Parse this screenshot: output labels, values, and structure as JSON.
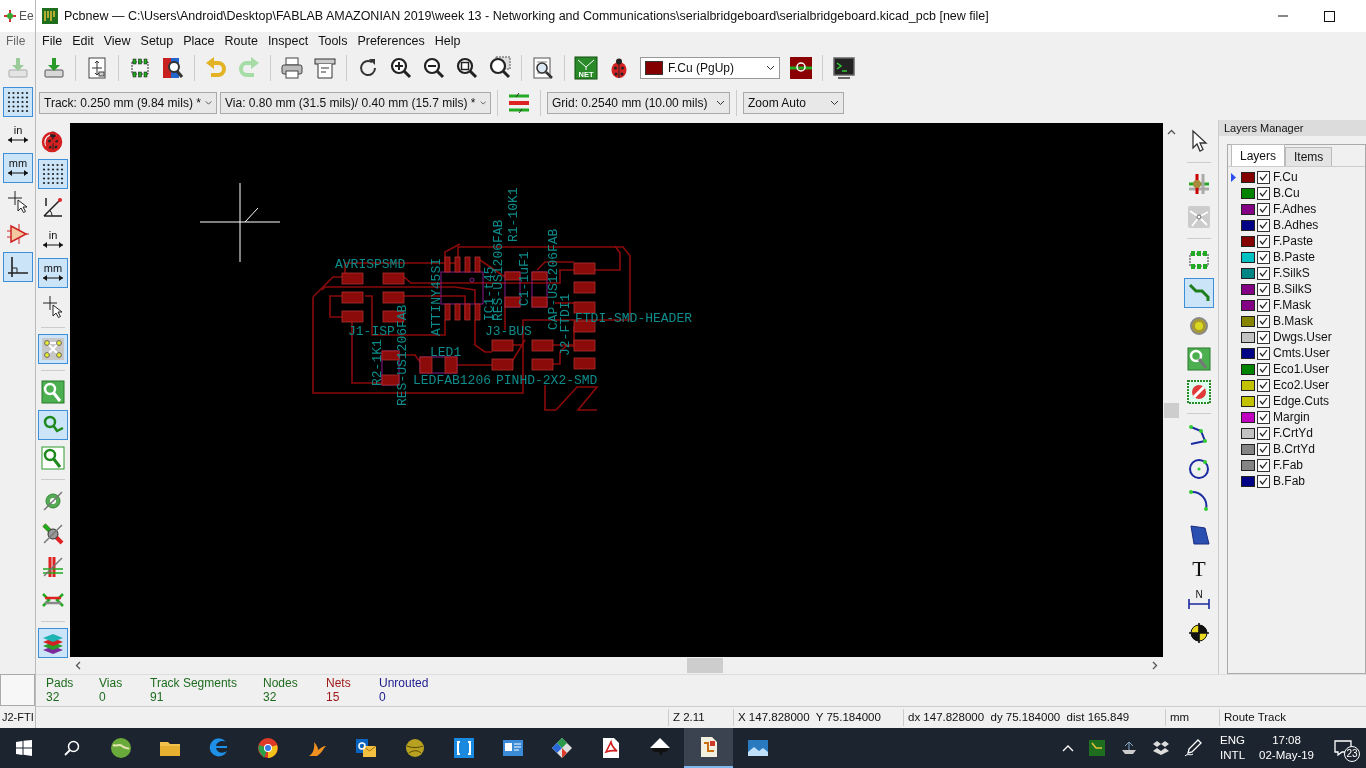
{
  "background_window": {
    "title": "Ee",
    "menu": "File",
    "status": "J2-FTI",
    "toolbar": [
      {
        "kind": "grid",
        "selected": true
      },
      {
        "kind": "units",
        "label": "in",
        "selected": false
      },
      {
        "kind": "units",
        "label": "mm",
        "selected": true
      },
      {
        "kind": "cursor",
        "selected": false
      },
      {
        "kind": "amp",
        "selected": false
      },
      {
        "kind": "ortho",
        "selected": true
      }
    ]
  },
  "window": {
    "title": "Pcbnew — C:\\Users\\Android\\Desktop\\FABLAB AMAZONIAN 2019\\week 13 - Networking and Communications\\serialbridgeboard\\serialbridgeboard.kicad_pcb [new file]"
  },
  "menu": [
    "File",
    "Edit",
    "View",
    "Setup",
    "Place",
    "Route",
    "Inspect",
    "Tools",
    "Preferences",
    "Help"
  ],
  "toolbar": [
    {
      "kind": "load"
    },
    {
      "kind": "sep"
    },
    {
      "kind": "page"
    },
    {
      "kind": "sep"
    },
    {
      "kind": "fpedit"
    },
    {
      "kind": "fpview"
    },
    {
      "kind": "sep"
    },
    {
      "kind": "undo"
    },
    {
      "kind": "redo"
    },
    {
      "kind": "sep"
    },
    {
      "kind": "print"
    },
    {
      "kind": "plot"
    },
    {
      "kind": "sep"
    },
    {
      "kind": "redraw"
    },
    {
      "kind": "zoomin"
    },
    {
      "kind": "zoomout"
    },
    {
      "kind": "zoomfit"
    },
    {
      "kind": "zoomsel"
    },
    {
      "kind": "sep"
    },
    {
      "kind": "find"
    },
    {
      "kind": "sep"
    },
    {
      "kind": "netlist",
      "label": "NET"
    },
    {
      "kind": "drc"
    },
    {
      "kind": "layer",
      "label": "F.Cu (PgUp)"
    },
    {
      "kind": "layerpair"
    },
    {
      "kind": "sep"
    },
    {
      "kind": "console"
    }
  ],
  "options_bar": {
    "track": "Track: 0.250 mm (9.84 mils) *",
    "via": "Via: 0.80 mm (31.5 mils)/ 0.40 mm (15.7 mils) *",
    "grid": "Grid: 0.2540 mm (10.00 mils)",
    "zoom": "Zoom Auto"
  },
  "left_toolbar": [
    {
      "kind": "drcoff",
      "selected": false
    },
    {
      "kind": "grid",
      "selected": true
    },
    {
      "kind": "polar",
      "selected": false
    },
    {
      "kind": "units",
      "label": "in",
      "selected": false
    },
    {
      "kind": "units",
      "label": "mm",
      "selected": true
    },
    {
      "kind": "cursor",
      "selected": false
    },
    {
      "kind": "sep"
    },
    {
      "kind": "ratsnest",
      "selected": true
    },
    {
      "kind": "sep"
    },
    {
      "kind": "zonefill",
      "selected": false
    },
    {
      "kind": "zoneoutline",
      "selected": true
    },
    {
      "kind": "zonesketch",
      "selected": false
    },
    {
      "kind": "sep"
    },
    {
      "kind": "padsketch",
      "selected": false
    },
    {
      "kind": "viasketch",
      "selected": false
    },
    {
      "kind": "tracksketch",
      "selected": false
    },
    {
      "kind": "contrast",
      "selected": false
    },
    {
      "kind": "sep"
    },
    {
      "kind": "layers",
      "selected": true
    }
  ],
  "board_labels": [
    "AVRISPSMD",
    "J1-ISP",
    "ATTINY45SI",
    "R1-10K1",
    "IC1-t45",
    "RES-US1206FAB",
    "C1-1uF1",
    "CAP-US1206FAB",
    "FTDI-SMD-HEADER",
    "J3-BUS",
    "J2-FTDI1",
    "LED1",
    "LEDFAB1206",
    "PINHD-2X2-SMD",
    "R2-1K1",
    "RES-US1206FAB"
  ],
  "right_toolbar": [
    {
      "kind": "select",
      "selected": false
    },
    {
      "kind": "sep"
    },
    {
      "kind": "highlight",
      "selected": false
    },
    {
      "kind": "localrats",
      "selected": false
    },
    {
      "kind": "sep"
    },
    {
      "kind": "footprint",
      "selected": false
    },
    {
      "kind": "track",
      "selected": true
    },
    {
      "kind": "via",
      "selected": false
    },
    {
      "kind": "zone",
      "selected": false
    },
    {
      "kind": "keepout",
      "selected": false
    },
    {
      "kind": "sep"
    },
    {
      "kind": "line",
      "selected": false
    },
    {
      "kind": "circle",
      "selected": false
    },
    {
      "kind": "arc",
      "selected": false
    },
    {
      "kind": "polygon",
      "selected": false
    },
    {
      "kind": "text",
      "label": "T",
      "selected": false
    },
    {
      "kind": "dimension",
      "label": "N",
      "selected": false
    },
    {
      "kind": "target",
      "selected": false
    }
  ],
  "layers_manager": {
    "title": "Layers Manager",
    "tabs": [
      {
        "label": "Layers",
        "selected": true
      },
      {
        "label": "Items",
        "selected": false
      }
    ],
    "layers": [
      {
        "name": "F.Cu",
        "color": "#840000",
        "checked": true,
        "selected": true
      },
      {
        "name": "B.Cu",
        "color": "#008400",
        "checked": true,
        "selected": false
      },
      {
        "name": "F.Adhes",
        "color": "#840084",
        "checked": true,
        "selected": false
      },
      {
        "name": "B.Adhes",
        "color": "#000084",
        "checked": true,
        "selected": false
      },
      {
        "name": "F.Paste",
        "color": "#840000",
        "checked": true,
        "selected": false
      },
      {
        "name": "B.Paste",
        "color": "#00c2c2",
        "checked": true,
        "selected": false
      },
      {
        "name": "F.SilkS",
        "color": "#008484",
        "checked": true,
        "selected": false
      },
      {
        "name": "B.SilkS",
        "color": "#840084",
        "checked": true,
        "selected": false
      },
      {
        "name": "F.Mask",
        "color": "#840084",
        "checked": true,
        "selected": false
      },
      {
        "name": "B.Mask",
        "color": "#848400",
        "checked": true,
        "selected": false
      },
      {
        "name": "Dwgs.User",
        "color": "#c2c2c2",
        "checked": true,
        "selected": false
      },
      {
        "name": "Cmts.User",
        "color": "#000084",
        "checked": true,
        "selected": false
      },
      {
        "name": "Eco1.User",
        "color": "#008400",
        "checked": true,
        "selected": false
      },
      {
        "name": "Eco2.User",
        "color": "#c2c200",
        "checked": true,
        "selected": false
      },
      {
        "name": "Edge.Cuts",
        "color": "#c2c200",
        "checked": true,
        "selected": false
      },
      {
        "name": "Margin",
        "color": "#c200c2",
        "checked": true,
        "selected": false
      },
      {
        "name": "F.CrtYd",
        "color": "#c2c2c2",
        "checked": true,
        "selected": false
      },
      {
        "name": "B.CrtYd",
        "color": "#848484",
        "checked": true,
        "selected": false
      },
      {
        "name": "F.Fab",
        "color": "#848484",
        "checked": true,
        "selected": false
      },
      {
        "name": "B.Fab",
        "color": "#000084",
        "checked": true,
        "selected": false
      }
    ]
  },
  "stats": [
    {
      "label": "Pads",
      "value": "32",
      "color": "#1e6b1e"
    },
    {
      "label": "Vias",
      "value": "0",
      "color": "#1e6b1e"
    },
    {
      "label": "Track Segments",
      "value": "91",
      "color": "#1e6b1e"
    },
    {
      "label": "Nodes",
      "value": "32",
      "color": "#1e6b1e"
    },
    {
      "label": "Nets",
      "value": "15",
      "color": "#a01818"
    },
    {
      "label": "Unrouted",
      "value": "0",
      "color": "#1a1a8c"
    }
  ],
  "status_bar": {
    "zoom": "Z 2.11",
    "position": "X 147.828000  Y 75.184000",
    "delta": "dx 147.828000  dy 75.184000  dist 165.849",
    "units": "mm",
    "tool": "Route Track"
  },
  "taskbar": {
    "apps": [
      {
        "kind": "globe",
        "selected": false
      },
      {
        "kind": "folder",
        "selected": false
      },
      {
        "kind": "edge",
        "selected": false
      },
      {
        "kind": "chrome",
        "selected": false
      },
      {
        "kind": "bird",
        "selected": false
      },
      {
        "kind": "mail",
        "selected": false
      },
      {
        "kind": "ball",
        "selected": false
      },
      {
        "kind": "bracket",
        "selected": false
      },
      {
        "kind": "card",
        "selected": false
      },
      {
        "kind": "diamond",
        "selected": false
      },
      {
        "kind": "pdf",
        "selected": false
      },
      {
        "kind": "ink",
        "selected": false
      },
      {
        "kind": "kicad",
        "selected": true
      },
      {
        "kind": "photo",
        "selected": false
      }
    ],
    "language": "ENG",
    "layout": "INTL",
    "time": "17:08",
    "date": "02-May-19",
    "notifications": "23"
  }
}
